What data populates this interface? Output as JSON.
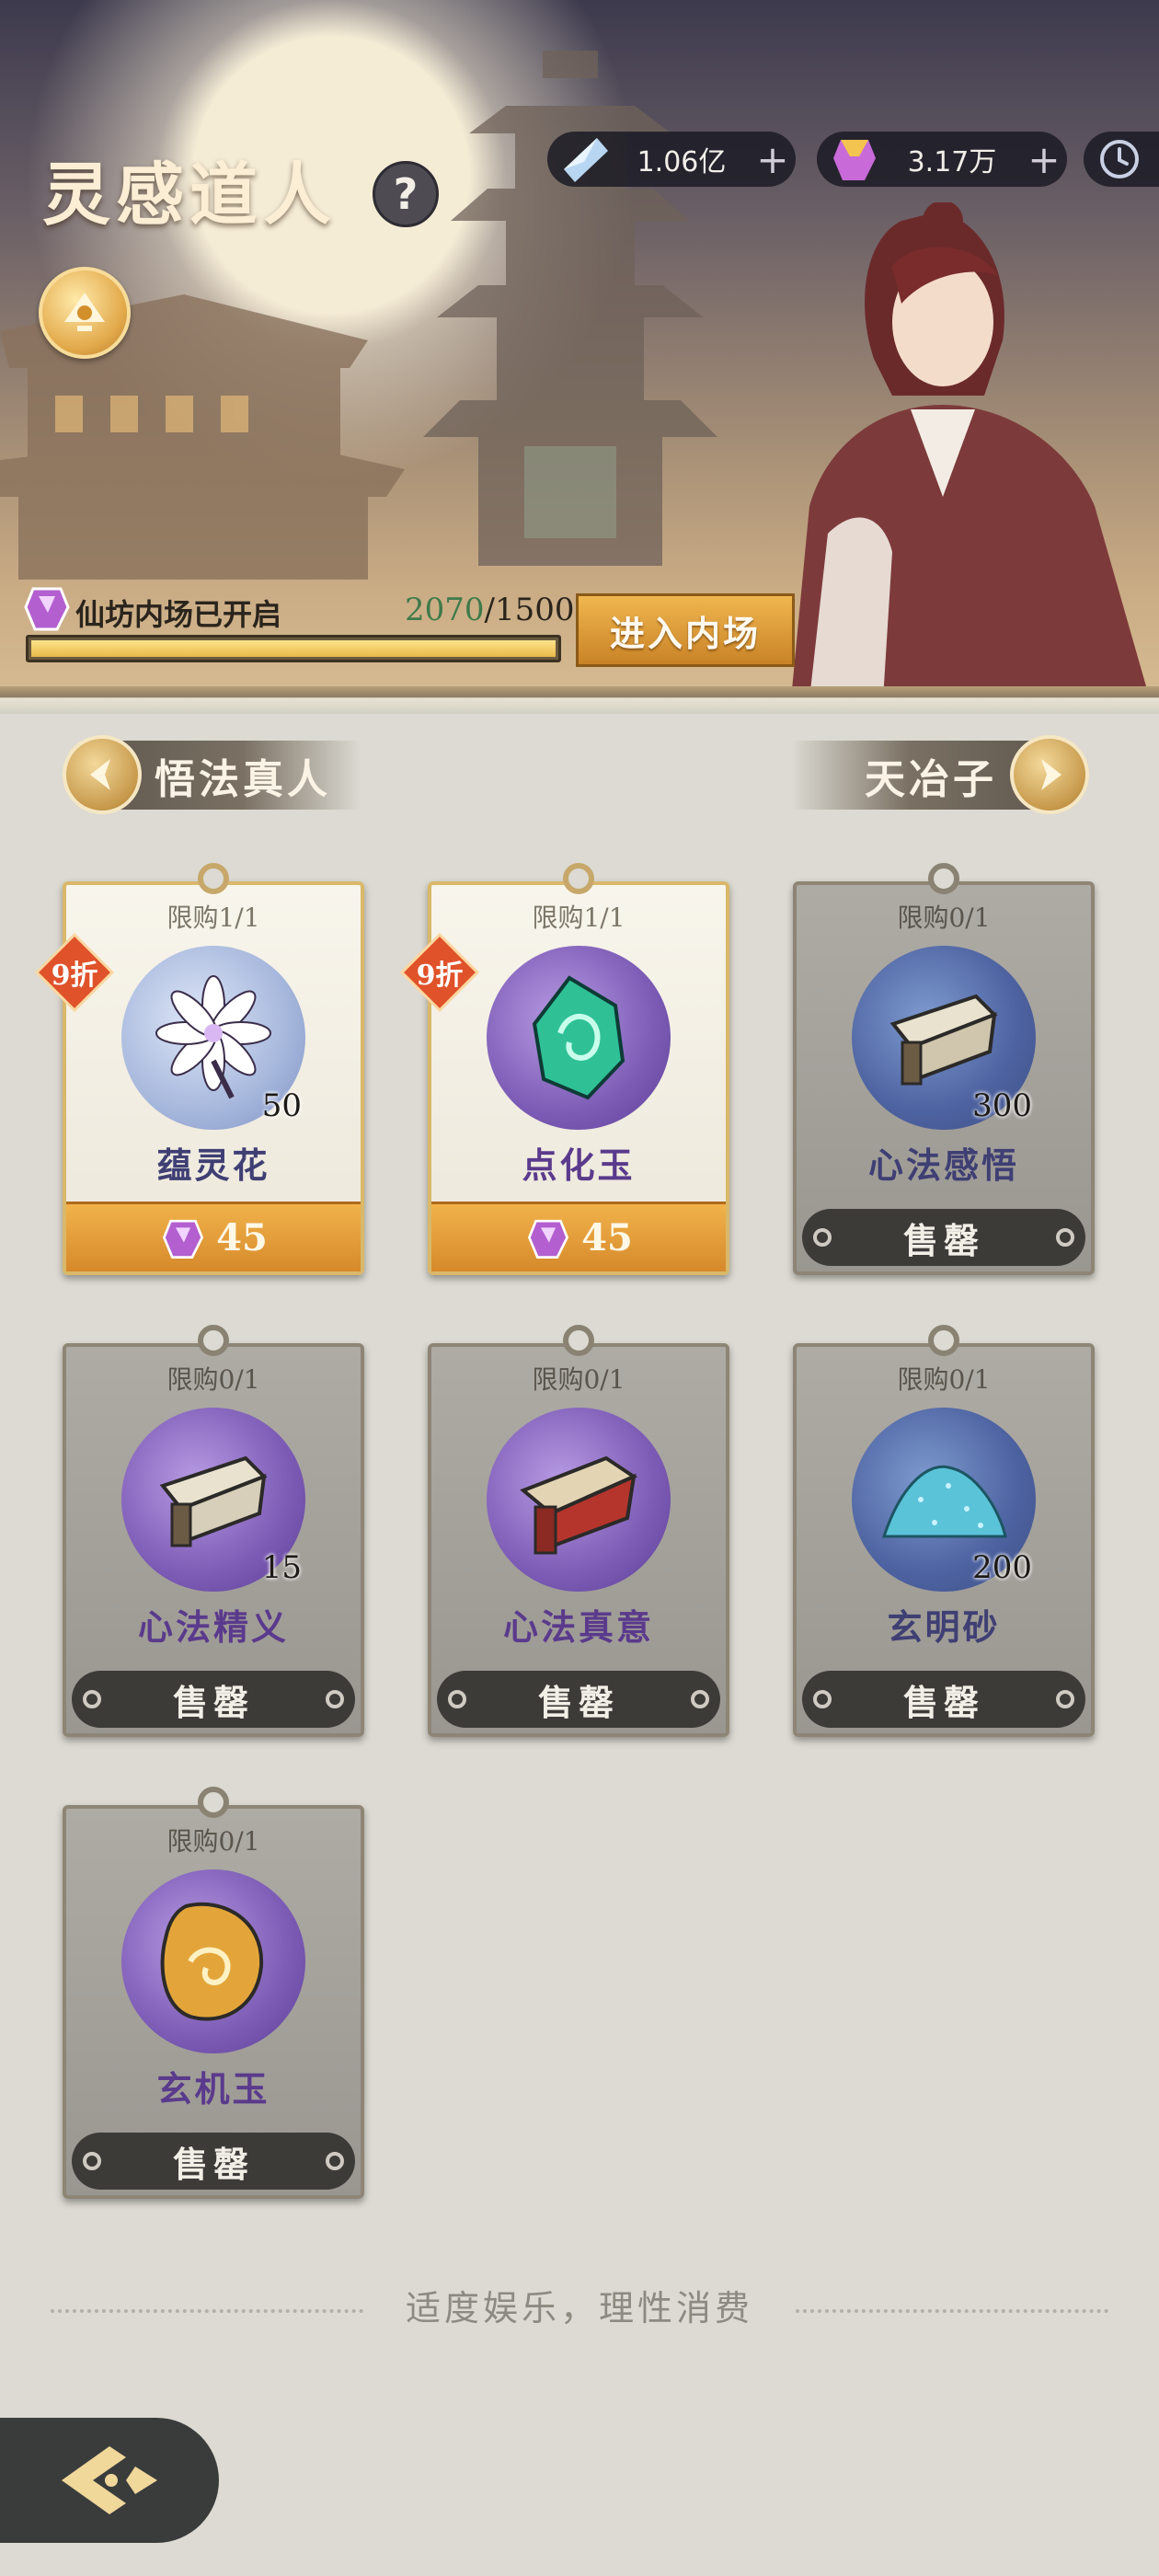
{
  "header": {
    "title": "灵感道人",
    "help_label": "?"
  },
  "currencies": [
    {
      "icon": "spirit-crystal-icon",
      "value": "1.06亿",
      "plus": "+"
    },
    {
      "icon": "purple-gem-icon",
      "value": "3.17万",
      "plus": "+"
    }
  ],
  "progress": {
    "label": "仙坊内场已开启",
    "current": "2070",
    "separator": "/",
    "total": "1500",
    "fill_fraction": 1.0,
    "enter_label": "进入内场"
  },
  "nav": {
    "prev_label": "悟法真人",
    "next_label": "天冶子"
  },
  "items": [
    {
      "limit": "限购1/1",
      "name": "蕴灵花",
      "qty": "50",
      "status": "available",
      "discount": "9折",
      "price": "45"
    },
    {
      "limit": "限购1/1",
      "name": "点化玉",
      "qty": "",
      "status": "available",
      "discount": "9折",
      "price": "45"
    },
    {
      "limit": "限购0/1",
      "name": "心法感悟",
      "qty": "300",
      "status": "soldout",
      "sold_label": "售罄"
    },
    {
      "limit": "限购0/1",
      "name": "心法精义",
      "qty": "15",
      "status": "soldout",
      "sold_label": "售罄"
    },
    {
      "limit": "限购0/1",
      "name": "心法真意",
      "qty": "",
      "status": "soldout",
      "sold_label": "售罄"
    },
    {
      "limit": "限购0/1",
      "name": "玄明砂",
      "qty": "200",
      "status": "soldout",
      "sold_label": "售罄"
    },
    {
      "limit": "限购0/1",
      "name": "玄机玉",
      "qty": "",
      "status": "soldout",
      "sold_label": "售罄"
    }
  ],
  "footer": {
    "note": "适度娱乐，理性消费"
  },
  "colors": {
    "price_bar": "#e39e38",
    "soldout_bar": "#3d3b38",
    "progress_fill": "#f3cc6a",
    "discount_badge": "#e0522a"
  }
}
